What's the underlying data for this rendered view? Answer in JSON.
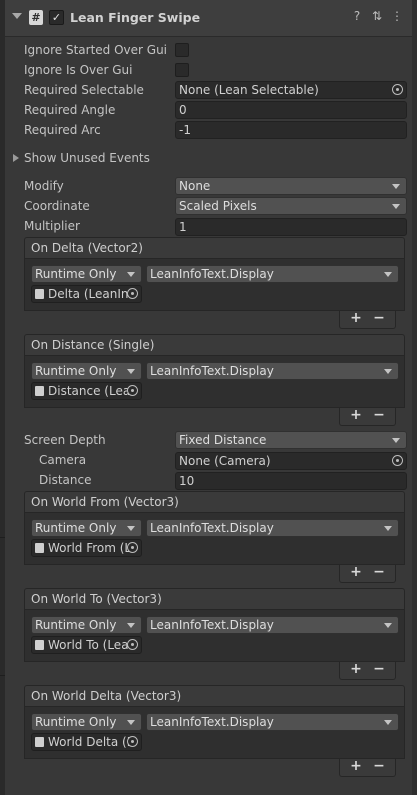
{
  "header": {
    "title": "Lean Finger Swipe",
    "script_glyph": "#",
    "checkbox": "✓",
    "help_icon": "?",
    "settings_icon": "⇅",
    "more_icon": "⋮"
  },
  "props": {
    "ignore_started": "Ignore Started Over Gui",
    "ignore_is_over": "Ignore Is Over Gui",
    "required_selectable": {
      "label": "Required Selectable",
      "value": "None (Lean Selectable)"
    },
    "required_angle": {
      "label": "Required Angle",
      "value": "0"
    },
    "required_arc": {
      "label": "Required Arc",
      "value": "-1"
    },
    "show_unused": "Show Unused Events",
    "modify": {
      "label": "Modify",
      "value": "None"
    },
    "coordinate": {
      "label": "Coordinate",
      "value": "Scaled Pixels"
    },
    "multiplier": {
      "label": "Multiplier",
      "value": "1"
    },
    "screen_depth": {
      "label": "Screen Depth",
      "value": "Fixed Distance"
    },
    "camera": {
      "label": "Camera",
      "value": "None (Camera)"
    },
    "distance": {
      "label": "Distance",
      "value": "10"
    }
  },
  "events": [
    {
      "title": "On Delta (Vector2)",
      "mode": "Runtime Only",
      "function": "LeanInfoText.Display",
      "object": "Delta (LeanIn"
    },
    {
      "title": "On Distance (Single)",
      "mode": "Runtime Only",
      "function": "LeanInfoText.Display",
      "object": "Distance (Lea"
    },
    {
      "title": "On World From (Vector3)",
      "mode": "Runtime Only",
      "function": "LeanInfoText.Display",
      "object": "World From (L"
    },
    {
      "title": "On World To (Vector3)",
      "mode": "Runtime Only",
      "function": "LeanInfoText.Display",
      "object": "World To (Lea"
    },
    {
      "title": "On World Delta (Vector3)",
      "mode": "Runtime Only",
      "function": "LeanInfoText.Display",
      "object": "World Delta (L"
    }
  ],
  "list_buttons": {
    "add": "+",
    "remove": "−"
  }
}
